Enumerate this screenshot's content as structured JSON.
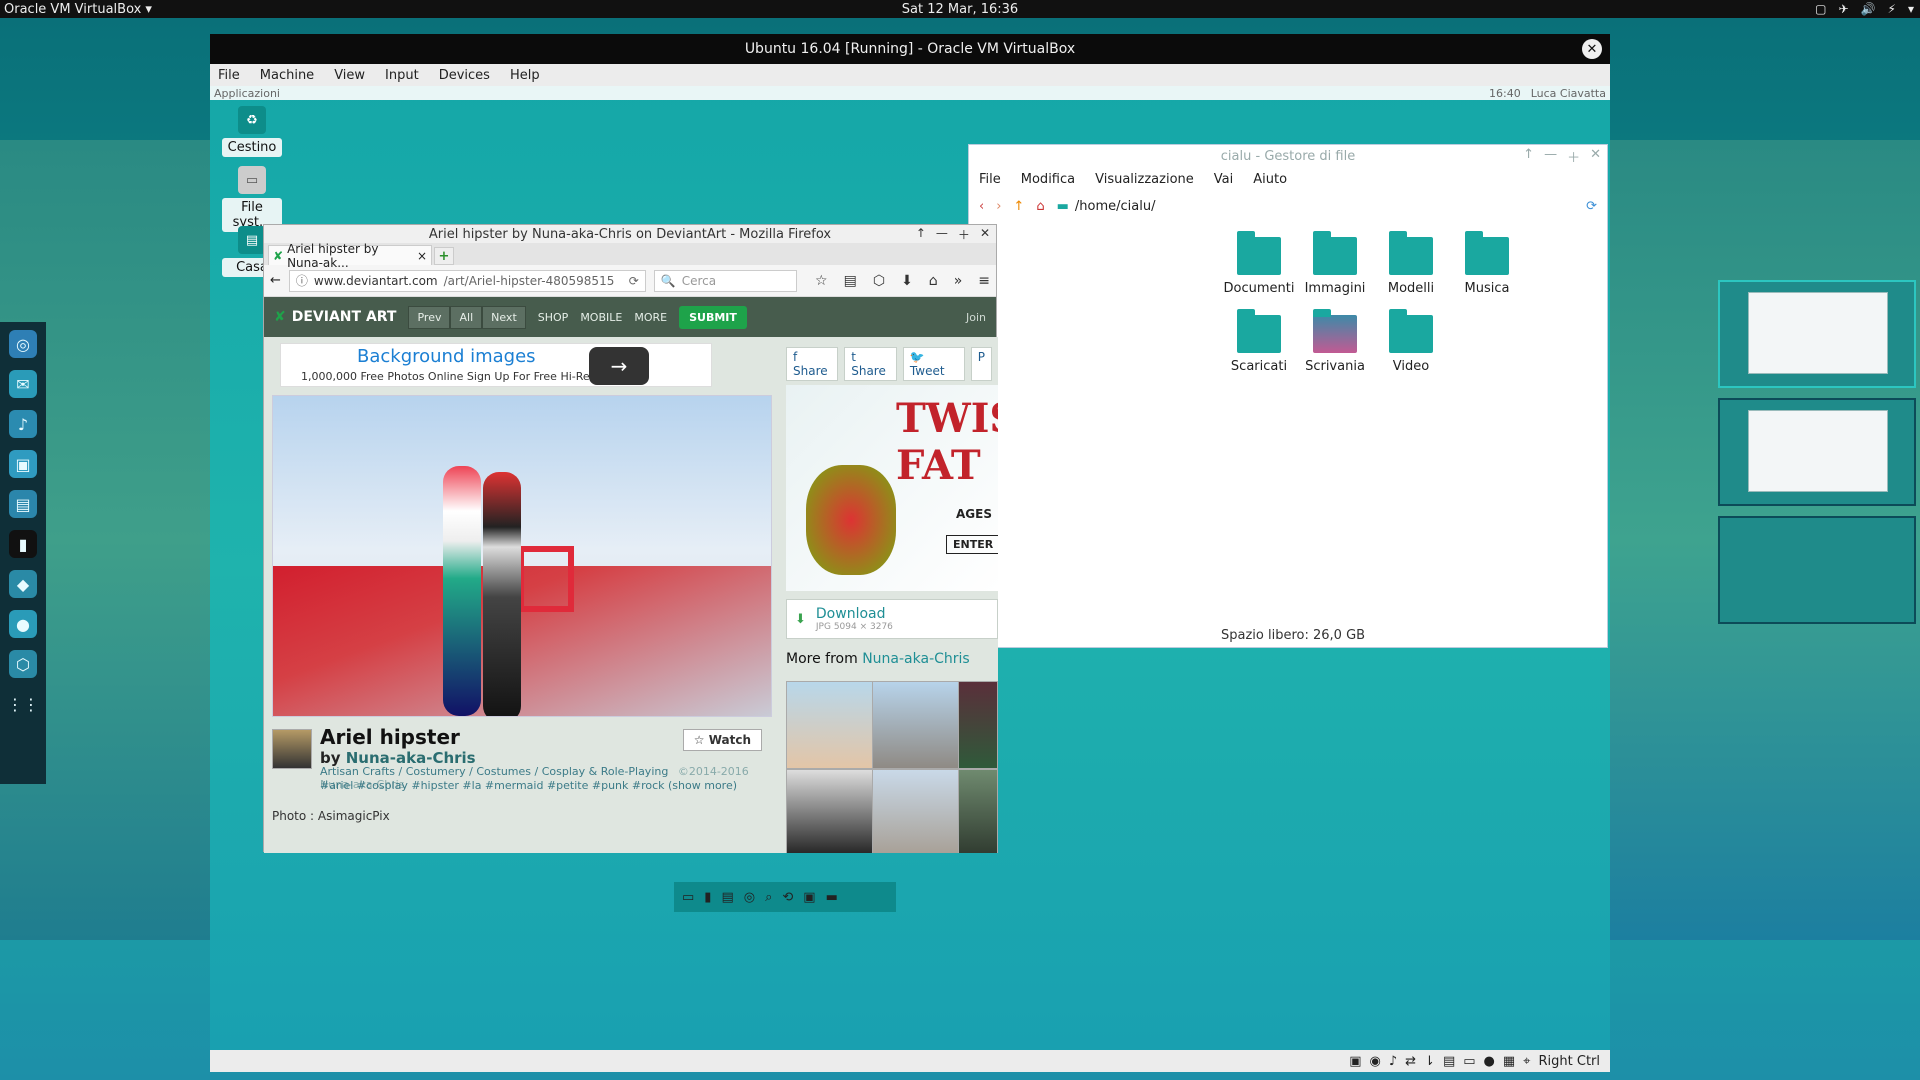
{
  "host": {
    "app_menu": "Oracle VM VirtualBox",
    "clock": "Sat 12 Mar, 16:36",
    "tray_icons": [
      "window-icon",
      "airplane-icon",
      "volume-icon",
      "battery-icon",
      "caret-down-icon"
    ]
  },
  "vm": {
    "title": "Ubuntu 16.04 [Running] - Oracle VM VirtualBox",
    "menu": [
      "File",
      "Machine",
      "View",
      "Input",
      "Devices",
      "Help"
    ],
    "status_right": "Right Ctrl"
  },
  "guest_topbar": {
    "left": "Applicazioni",
    "time": "16:40",
    "user": "Luca Ciavatta"
  },
  "desktop_icons": [
    "Cestino",
    "File syst...",
    "Casa"
  ],
  "file_manager": {
    "title": "cialu - Gestore di file",
    "menu": [
      "File",
      "Modifica",
      "Visualizzazione",
      "Vai",
      "Aiuto"
    ],
    "path": "/home/cialu/",
    "folders": [
      "Documenti",
      "Immagini",
      "Modelli",
      "Musica",
      "Scaricati",
      "Scrivania",
      "Video"
    ],
    "status": "Spazio libero: 26,0 GB"
  },
  "firefox": {
    "window_title": "Ariel hipster by Nuna-aka-Chris on DeviantArt - Mozilla Firefox",
    "tab_label": "Ariel hipster by Nuna-ak...",
    "url_domain": "www.deviantart.com",
    "url_path": "/art/Ariel-hipster-480598515",
    "search_placeholder": "Cerca",
    "header": {
      "logo": "DEVIANT ART",
      "prev": "Prev",
      "all": "All",
      "next": "Next",
      "nav": [
        "SHOP",
        "MOBILE",
        "MORE"
      ],
      "submit": "SUBMIT",
      "join": "Join"
    },
    "ad": {
      "title": "Background images",
      "subtitle": "1,000,000 Free Photos Online Sign Up For Free Hi-Res Images!"
    },
    "art": {
      "title": "Ariel hipster",
      "by_label": "by",
      "author": "Nuna-aka-Chris",
      "categories": "Artisan Crafts / Costumery / Costumes / Cosplay & Role-Playing",
      "copyright": "©2014-2016 Nuna-aka-Chris",
      "tags": "#ariel #cosplay #hipster #la #mermaid #petite #punk #rock (show more)",
      "watch": "Watch",
      "photo_credit": "Photo : AsimagicPix"
    },
    "sidebar": {
      "share_buttons": [
        "Share",
        "Share",
        "Tweet"
      ],
      "ad_text": "TWIS FAT",
      "ad_sub": "AGES",
      "ad_button": "ENTER",
      "download_label": "Download",
      "download_meta": "JPG 5094 × 3276",
      "more_from_prefix": "More from",
      "more_from_author": "Nuna-aka-Chris"
    }
  }
}
